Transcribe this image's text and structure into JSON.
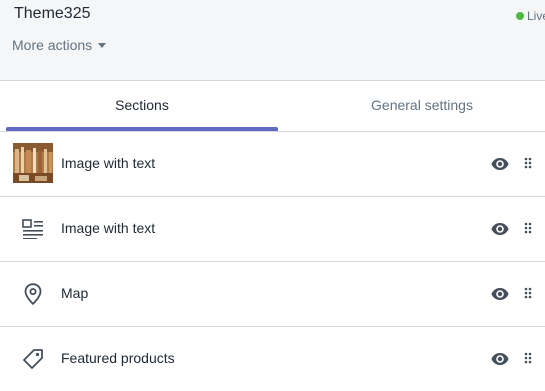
{
  "header": {
    "theme_name": "Theme325",
    "status_label": "Live",
    "status_color": "#50b83c",
    "more_actions_label": "More actions"
  },
  "tabs": [
    {
      "label": "Sections",
      "active": true
    },
    {
      "label": "General settings",
      "active": false
    }
  ],
  "accent_color": "#5c6ac4",
  "sections": [
    {
      "label": "Image with text",
      "icon": "image-thumbnail"
    },
    {
      "label": "Image with text",
      "icon": "text-lines-icon"
    },
    {
      "label": "Map",
      "icon": "location-pin-icon"
    },
    {
      "label": "Featured products",
      "icon": "tag-icon"
    }
  ]
}
